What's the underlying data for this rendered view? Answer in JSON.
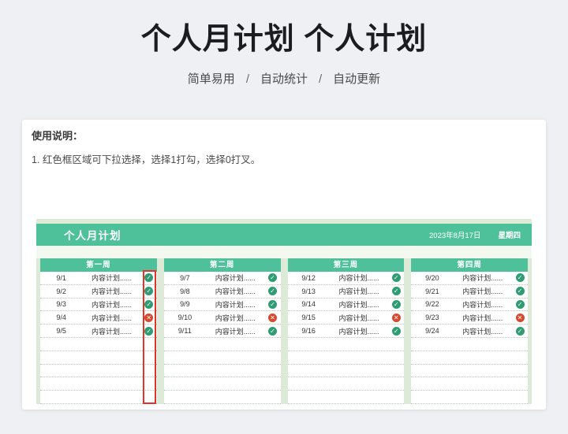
{
  "page": {
    "title": "个人月计划 个人计划",
    "features": [
      "简单易用",
      "自动统计",
      "自动更新"
    ],
    "feature_separator": "/"
  },
  "instructions": {
    "heading": "使用说明：",
    "line1": "1. 红色框区域可下拉选择，选择1打勾，选择0打叉。"
  },
  "sheet": {
    "title": "个人月计划",
    "date": "2023年8月17日",
    "weekday": "星期四",
    "empty_rows_per_week": 5,
    "weeks": [
      {
        "label": "第一周",
        "dropdown_highlight": true,
        "rows": [
          {
            "date": "9/1",
            "content": "内容计划......",
            "status": "check"
          },
          {
            "date": "9/2",
            "content": "内容计划......",
            "status": "check"
          },
          {
            "date": "9/3",
            "content": "内容计划......",
            "status": "check"
          },
          {
            "date": "9/4",
            "content": "内容计划......",
            "status": "cross"
          },
          {
            "date": "9/5",
            "content": "内容计划......",
            "status": "check"
          }
        ]
      },
      {
        "label": "第二周",
        "dropdown_highlight": false,
        "rows": [
          {
            "date": "9/7",
            "content": "内容计划......",
            "status": "check"
          },
          {
            "date": "9/8",
            "content": "内容计划......",
            "status": "check"
          },
          {
            "date": "9/9",
            "content": "内容计划......",
            "status": "check"
          },
          {
            "date": "9/10",
            "content": "内容计划......",
            "status": "cross"
          },
          {
            "date": "9/11",
            "content": "内容计划......",
            "status": "check"
          }
        ]
      },
      {
        "label": "第三周",
        "dropdown_highlight": false,
        "rows": [
          {
            "date": "9/12",
            "content": "内容计划......",
            "status": "check"
          },
          {
            "date": "9/13",
            "content": "内容计划......",
            "status": "check"
          },
          {
            "date": "9/14",
            "content": "内容计划......",
            "status": "check"
          },
          {
            "date": "9/15",
            "content": "内容计划......",
            "status": "cross"
          },
          {
            "date": "9/16",
            "content": "内容计划......",
            "status": "check"
          }
        ]
      },
      {
        "label": "第四周",
        "dropdown_highlight": false,
        "rows": [
          {
            "date": "9/20",
            "content": "内容计划......",
            "status": "check"
          },
          {
            "date": "9/21",
            "content": "内容计划......",
            "status": "check"
          },
          {
            "date": "9/22",
            "content": "内容计划......",
            "status": "check"
          },
          {
            "date": "9/23",
            "content": "内容计划......",
            "status": "cross"
          },
          {
            "date": "9/24",
            "content": "内容计划......",
            "status": "check"
          }
        ]
      }
    ]
  },
  "colors": {
    "accent_green": "#4fc19a",
    "light_green": "#dcead7",
    "check_green": "#2f9c73",
    "cross_red": "#d7492e",
    "highlight_red": "#e53329"
  }
}
